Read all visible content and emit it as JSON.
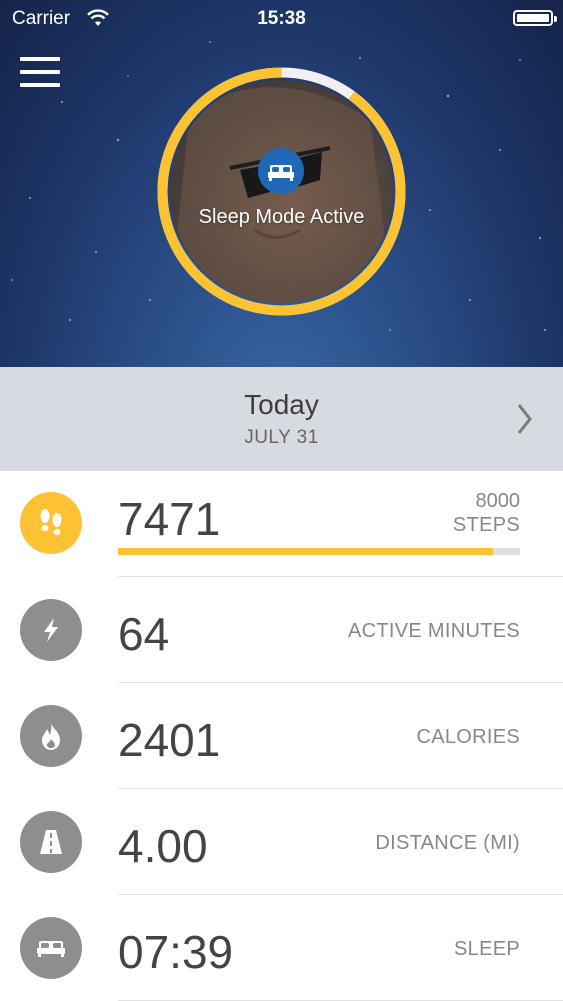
{
  "status_bar": {
    "carrier": "Carrier",
    "time": "15:38"
  },
  "hero": {
    "sleep_mode_text": "Sleep Mode Active",
    "ring_progress": 0.9,
    "accent_color": "#fbc234",
    "badge_color": "#1e68b4"
  },
  "date_bar": {
    "title": "Today",
    "subtitle": "JULY 31"
  },
  "stats": [
    {
      "icon": "footprints-icon",
      "value": "7471",
      "goal": "8000",
      "label": "STEPS",
      "progress": 0.934
    },
    {
      "icon": "lightning-icon",
      "value": "64",
      "label": "ACTIVE MINUTES"
    },
    {
      "icon": "flame-icon",
      "value": "2401",
      "label": "CALORIES"
    },
    {
      "icon": "road-icon",
      "value": "4.00",
      "label": "DISTANCE (MI)"
    },
    {
      "icon": "bed-icon",
      "value": "07:39",
      "label": "SLEEP"
    }
  ]
}
